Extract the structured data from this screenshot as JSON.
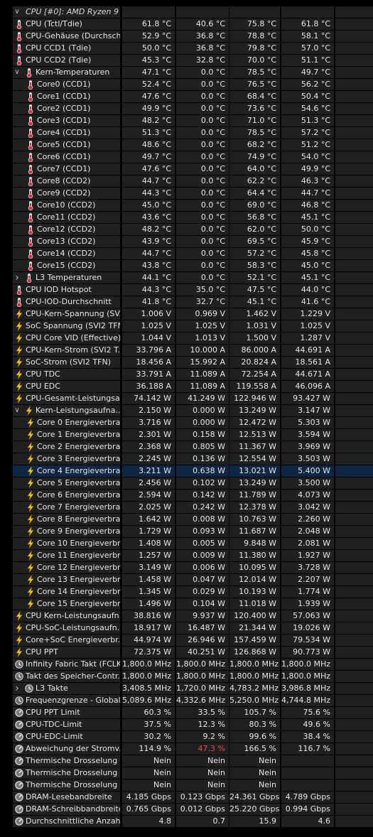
{
  "colors": {
    "background": "#000000",
    "cell": "#202020",
    "selected": "#0e2745",
    "text": "#e6e6e6",
    "alert": "#f04545"
  },
  "header": {
    "label": "CPU [#0]: AMD Ryzen 9 ..."
  },
  "rows": [
    {
      "icon": "thermometer-icon",
      "label": "CPU (Tctl/Tdie)",
      "v": [
        "61.8 °C",
        "40.6 °C",
        "75.8 °C",
        "61.8 °C"
      ]
    },
    {
      "icon": "thermometer-icon",
      "label": "CPU-Gehäuse (Durchsch...",
      "v": [
        "52.9 °C",
        "36.8 °C",
        "78.8 °C",
        "58.1 °C"
      ]
    },
    {
      "icon": "thermometer-icon",
      "label": "CPU CCD1 (Tdie)",
      "v": [
        "50.0 °C",
        "36.8 °C",
        "79.8 °C",
        "57.0 °C"
      ]
    },
    {
      "icon": "thermometer-icon",
      "label": "CPU CCD2 (Tdie)",
      "v": [
        "45.3 °C",
        "32.8 °C",
        "70.0 °C",
        "51.1 °C"
      ]
    },
    {
      "icon": "thermometer-icon",
      "label": "Kern-Temperaturen",
      "v": [
        "47.1 °C",
        "0.0 °C",
        "78.5 °C",
        "49.7 °C"
      ],
      "expand": "expanded"
    },
    {
      "icon": "thermometer-icon",
      "label": "Core0 (CCD1)",
      "v": [
        "52.4 °C",
        "0.0 °C",
        "76.5 °C",
        "56.2 °C"
      ],
      "indent": 1
    },
    {
      "icon": "thermometer-icon",
      "label": "Core1 (CCD1)",
      "v": [
        "47.6 °C",
        "0.0 °C",
        "68.4 °C",
        "50.4 °C"
      ],
      "indent": 1
    },
    {
      "icon": "thermometer-icon",
      "label": "Core2 (CCD1)",
      "v": [
        "49.9 °C",
        "0.0 °C",
        "73.6 °C",
        "54.6 °C"
      ],
      "indent": 1
    },
    {
      "icon": "thermometer-icon",
      "label": "Core3 (CCD1)",
      "v": [
        "48.2 °C",
        "0.0 °C",
        "71.0 °C",
        "51.3 °C"
      ],
      "indent": 1
    },
    {
      "icon": "thermometer-icon",
      "label": "Core4 (CCD1)",
      "v": [
        "51.3 °C",
        "0.0 °C",
        "78.5 °C",
        "57.2 °C"
      ],
      "indent": 1
    },
    {
      "icon": "thermometer-icon",
      "label": "Core5 (CCD1)",
      "v": [
        "48.6 °C",
        "0.0 °C",
        "68.2 °C",
        "51.2 °C"
      ],
      "indent": 1
    },
    {
      "icon": "thermometer-icon",
      "label": "Core6 (CCD1)",
      "v": [
        "49.7 °C",
        "0.0 °C",
        "74.9 °C",
        "54.0 °C"
      ],
      "indent": 1
    },
    {
      "icon": "thermometer-icon",
      "label": "Core7 (CCD1)",
      "v": [
        "47.6 °C",
        "0.0 °C",
        "64.0 °C",
        "49.9 °C"
      ],
      "indent": 1
    },
    {
      "icon": "thermometer-icon",
      "label": "Core8 (CCD2)",
      "v": [
        "44.7 °C",
        "0.0 °C",
        "62.2 °C",
        "46.3 °C"
      ],
      "indent": 1
    },
    {
      "icon": "thermometer-icon",
      "label": "Core9 (CCD2)",
      "v": [
        "44.3 °C",
        "0.0 °C",
        "64.4 °C",
        "44.7 °C"
      ],
      "indent": 1
    },
    {
      "icon": "thermometer-icon",
      "label": "Core10 (CCD2)",
      "v": [
        "45.0 °C",
        "0.0 °C",
        "69.0 °C",
        "46.8 °C"
      ],
      "indent": 1
    },
    {
      "icon": "thermometer-icon",
      "label": "Core11 (CCD2)",
      "v": [
        "43.6 °C",
        "0.0 °C",
        "56.8 °C",
        "45.1 °C"
      ],
      "indent": 1
    },
    {
      "icon": "thermometer-icon",
      "label": "Core12 (CCD2)",
      "v": [
        "48.2 °C",
        "0.0 °C",
        "62.0 °C",
        "50.0 °C"
      ],
      "indent": 1
    },
    {
      "icon": "thermometer-icon",
      "label": "Core13 (CCD2)",
      "v": [
        "43.9 °C",
        "0.0 °C",
        "69.5 °C",
        "45.9 °C"
      ],
      "indent": 1
    },
    {
      "icon": "thermometer-icon",
      "label": "Core14 (CCD2)",
      "v": [
        "44.7 °C",
        "0.0 °C",
        "57.2 °C",
        "45.8 °C"
      ],
      "indent": 1
    },
    {
      "icon": "thermometer-icon",
      "label": "Core15 (CCD2)",
      "v": [
        "43.8 °C",
        "0.0 °C",
        "58.3 °C",
        "45.0 °C"
      ],
      "indent": 1
    },
    {
      "icon": "thermometer-icon",
      "label": "L3 Temperaturen",
      "v": [
        "44.1 °C",
        "0.0 °C",
        "52.1 °C",
        "45.1 °C"
      ],
      "expand": "collapsed"
    },
    {
      "icon": "thermometer-icon",
      "label": "CPU IOD Hotspot",
      "v": [
        "44.3 °C",
        "35.0 °C",
        "47.5 °C",
        "44.0 °C"
      ]
    },
    {
      "icon": "thermometer-icon",
      "label": "CPU-IOD-Durchschnitt",
      "v": [
        "41.8 °C",
        "32.7 °C",
        "45.1 °C",
        "41.6 °C"
      ]
    },
    {
      "icon": "lightning-icon",
      "label": "CPU-Kern-Spannung (SV...",
      "v": [
        "1.006 V",
        "0.969 V",
        "1.462 V",
        "1.229 V"
      ]
    },
    {
      "icon": "lightning-icon",
      "label": "SoC Spannung (SVI2 TFN)",
      "v": [
        "1.025 V",
        "1.025 V",
        "1.031 V",
        "1.025 V"
      ]
    },
    {
      "icon": "lightning-icon",
      "label": "CPU Core VID (Effective)",
      "v": [
        "1.044 V",
        "1.013 V",
        "1.500 V",
        "1.287 V"
      ]
    },
    {
      "icon": "lightning-icon",
      "label": "CPU-Kern-Strom (SVI2 T...",
      "v": [
        "33.796 A",
        "10.000 A",
        "86.000 A",
        "44.691 A"
      ]
    },
    {
      "icon": "lightning-icon",
      "label": "SoC-Strom (SVI2 TFN)",
      "v": [
        "18.456 A",
        "15.992 A",
        "20.824 A",
        "18.561 A"
      ]
    },
    {
      "icon": "lightning-icon",
      "label": "CPU TDC",
      "v": [
        "33.791 A",
        "11.089 A",
        "72.254 A",
        "44.671 A"
      ]
    },
    {
      "icon": "lightning-icon",
      "label": "CPU EDC",
      "v": [
        "36.188 A",
        "11.089 A",
        "119.558 A",
        "46.096 A"
      ]
    },
    {
      "icon": "lightning-icon",
      "label": "CPU-Gesamt-Leistungsa...",
      "v": [
        "74.142 W",
        "41.249 W",
        "122.946 W",
        "93.427 W"
      ]
    },
    {
      "icon": "lightning-icon",
      "label": "Kern-Leistungsaufna...",
      "v": [
        "2.150 W",
        "0.000 W",
        "13.249 W",
        "3.147 W"
      ],
      "expand": "expanded"
    },
    {
      "icon": "lightning-icon",
      "label": "Core 0 Energieverbra...",
      "v": [
        "3.716 W",
        "0.000 W",
        "12.472 W",
        "5.303 W"
      ],
      "indent": 1
    },
    {
      "icon": "lightning-icon",
      "label": "Core 1 Energieverbra...",
      "v": [
        "2.301 W",
        "0.158 W",
        "12.513 W",
        "3.594 W"
      ],
      "indent": 1
    },
    {
      "icon": "lightning-icon",
      "label": "Core 2 Energieverbra...",
      "v": [
        "2.368 W",
        "0.805 W",
        "11.367 W",
        "3.969 W"
      ],
      "indent": 1
    },
    {
      "icon": "lightning-icon",
      "label": "Core 3 Energieverbra...",
      "v": [
        "2.245 W",
        "0.136 W",
        "12.554 W",
        "3.503 W"
      ],
      "indent": 1
    },
    {
      "icon": "lightning-icon",
      "label": "Core 4 Energieverbra...",
      "v": [
        "3.211 W",
        "0.638 W",
        "13.021 W",
        "5.400 W"
      ],
      "indent": 1,
      "selected": true
    },
    {
      "icon": "lightning-icon",
      "label": "Core 5 Energieverbra...",
      "v": [
        "2.456 W",
        "0.102 W",
        "13.249 W",
        "3.500 W"
      ],
      "indent": 1
    },
    {
      "icon": "lightning-icon",
      "label": "Core 6 Energieverbra...",
      "v": [
        "2.594 W",
        "0.142 W",
        "11.789 W",
        "4.073 W"
      ],
      "indent": 1
    },
    {
      "icon": "lightning-icon",
      "label": "Core 7 Energieverbra...",
      "v": [
        "2.025 W",
        "0.242 W",
        "12.378 W",
        "3.042 W"
      ],
      "indent": 1
    },
    {
      "icon": "lightning-icon",
      "label": "Core 8 Energieverbra...",
      "v": [
        "1.642 W",
        "0.008 W",
        "10.763 W",
        "2.260 W"
      ],
      "indent": 1
    },
    {
      "icon": "lightning-icon",
      "label": "Core 9 Energieverbra...",
      "v": [
        "1.729 W",
        "0.093 W",
        "11.687 W",
        "2.048 W"
      ],
      "indent": 1
    },
    {
      "icon": "lightning-icon",
      "label": "Core 10 Energieverbr...",
      "v": [
        "1.408 W",
        "0.005 W",
        "9.848 W",
        "2.081 W"
      ],
      "indent": 1
    },
    {
      "icon": "lightning-icon",
      "label": "Core 11 Energieverbr...",
      "v": [
        "1.257 W",
        "0.009 W",
        "11.380 W",
        "1.927 W"
      ],
      "indent": 1
    },
    {
      "icon": "lightning-icon",
      "label": "Core 12 Energieverbr...",
      "v": [
        "3.149 W",
        "0.006 W",
        "10.095 W",
        "3.728 W"
      ],
      "indent": 1
    },
    {
      "icon": "lightning-icon",
      "label": "Core 13 Energieverbr...",
      "v": [
        "1.458 W",
        "0.047 W",
        "12.014 W",
        "2.207 W"
      ],
      "indent": 1
    },
    {
      "icon": "lightning-icon",
      "label": "Core 14 Energieverbr...",
      "v": [
        "1.345 W",
        "0.029 W",
        "10.193 W",
        "1.774 W"
      ],
      "indent": 1
    },
    {
      "icon": "lightning-icon",
      "label": "Core 15 Energieverbr...",
      "v": [
        "1.496 W",
        "0.104 W",
        "11.018 W",
        "1.939 W"
      ],
      "indent": 1
    },
    {
      "icon": "lightning-icon",
      "label": "CPU Kern-Leistungsaufn...",
      "v": [
        "38.816 W",
        "9.937 W",
        "120.400 W",
        "57.063 W"
      ]
    },
    {
      "icon": "lightning-icon",
      "label": "CPU-SoC-Leistungsaufn...",
      "v": [
        "18.917 W",
        "16.487 W",
        "21.344 W",
        "19.026 W"
      ]
    },
    {
      "icon": "lightning-icon",
      "label": "Core+SoC Energieverbr...",
      "v": [
        "44.974 W",
        "26.946 W",
        "157.459 W",
        "79.534 W"
      ]
    },
    {
      "icon": "lightning-icon",
      "label": "CPU PPT",
      "v": [
        "72.375 W",
        "40.251 W",
        "126.868 W",
        "90.773 W"
      ]
    },
    {
      "icon": "clock-icon",
      "label": "Infinity Fabric Takt (FCLK)",
      "v": [
        "1,800.0 MHz",
        "1,800.0 MHz",
        "1,800.0 MHz",
        "1,800.0 MHz"
      ]
    },
    {
      "icon": "clock-icon",
      "label": "Takt des Speicher-Contr...",
      "v": [
        "1,800.0 MHz",
        "1,800.0 MHz",
        "1,800.0 MHz",
        "1,800.0 MHz"
      ]
    },
    {
      "icon": "clock-icon",
      "label": "L3 Takte",
      "v": [
        "3,408.5 MHz",
        "1,720.0 MHz",
        "4,783.2 MHz",
        "3,986.8 MHz"
      ],
      "expand": "collapsed"
    },
    {
      "icon": "clock-icon",
      "label": "Frequenzgrenze - Global",
      "v": [
        "5,089.6 MHz",
        "4,332.6 MHz",
        "5,250.0 MHz",
        "4,744.8 MHz"
      ]
    },
    {
      "icon": "gauge-icon",
      "label": "CPU PPT Limit",
      "v": [
        "60.3 %",
        "33.5 %",
        "105.7 %",
        "75.6 %"
      ]
    },
    {
      "icon": "gauge-icon",
      "label": "CPU-TDC-Limit",
      "v": [
        "37.5 %",
        "12.3 %",
        "80.3 %",
        "49.6 %"
      ]
    },
    {
      "icon": "gauge-icon",
      "label": "CPU-EDC-Limit",
      "v": [
        "30.2 %",
        "9.2 %",
        "99.6 %",
        "38.4 %"
      ]
    },
    {
      "icon": "gauge-icon",
      "label": "Abweichung der Stromv...",
      "v": [
        "114.9 %",
        "47.3 %",
        "166.5 %",
        "116.7 %"
      ],
      "alert": 1
    },
    {
      "icon": "gauge-icon",
      "label": "Thermische Drosselung (...",
      "v": [
        "Nein",
        "Nein",
        "Nein",
        ""
      ]
    },
    {
      "icon": "gauge-icon",
      "label": "Thermische Drosselung (...",
      "v": [
        "Nein",
        "Nein",
        "Nein",
        ""
      ]
    },
    {
      "icon": "gauge-icon",
      "label": "Thermische Drosselung (...",
      "v": [
        "Nein",
        "Nein",
        "Nein",
        ""
      ]
    },
    {
      "icon": "gauge-icon",
      "label": "DRAM-Lesebandbreite",
      "v": [
        "4.185 Gbps",
        "0.123 Gbps",
        "24.361 Gbps",
        "4.789 Gbps"
      ]
    },
    {
      "icon": "gauge-icon",
      "label": "DRAM-Schreibbandbreite",
      "v": [
        "0.765 Gbps",
        "0.012 Gbps",
        "25.220 Gbps",
        "0.994 Gbps"
      ]
    },
    {
      "icon": "gauge-icon",
      "label": "Durchschnittliche Anzahl ...",
      "v": [
        "4.8",
        "0.7",
        "15.9",
        "4.6"
      ]
    }
  ]
}
